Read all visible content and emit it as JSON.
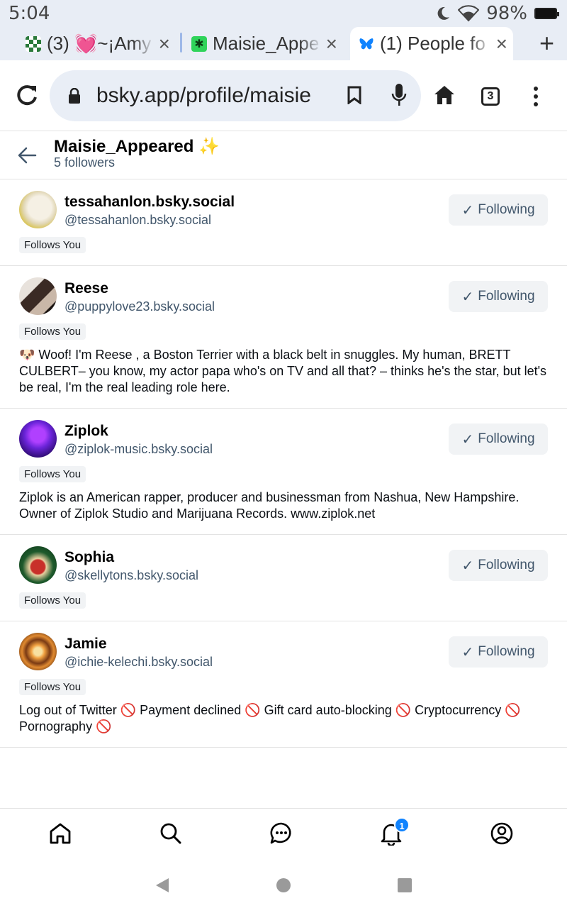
{
  "status_bar": {
    "time": "5:04",
    "battery_pct": "98%",
    "icons": [
      "moon-icon",
      "wifi-icon",
      "battery-icon"
    ]
  },
  "tabs": [
    {
      "favicon": "checker-icon",
      "title": "(3) 💓~¡Amy",
      "active": false
    },
    {
      "favicon": "green-leaf-icon",
      "title": "Maisie_Appe",
      "active": false
    },
    {
      "favicon": "butterfly-icon",
      "title": "(1) People fo",
      "active": true
    }
  ],
  "toolbar": {
    "url": "bsky.app/profile/maisie",
    "tab_count": "3"
  },
  "header": {
    "title": "Maisie_Appeared ✨",
    "subtitle": "5 followers"
  },
  "follow_label": "Following",
  "follows_you_label": "Follows You",
  "followers": [
    {
      "name": "tessahanlon.bsky.social",
      "handle": "@tessahanlon.bsky.social",
      "bio": "",
      "avatar_colors": [
        "#f5f0e4",
        "#d8c24a"
      ]
    },
    {
      "name": "Reese",
      "handle": "@puppylove23.bsky.social",
      "bio": "🐶 Woof! I'm Reese , a Boston Terrier with a black belt in snuggles. My human, BRETT CULBERT– you know, my actor papa who's on TV and all that? – thinks he's the star, but let's be real, I'm the real leading role here.",
      "avatar_colors": [
        "#e8e2dc",
        "#3a2a24"
      ]
    },
    {
      "name": "Ziplok",
      "handle": "@ziplok-music.bsky.social",
      "bio": "Ziplok is an American rapper, producer and businessman from Nashua, New Hampshire. Owner of Ziplok Studio and Marijuana Records. www.ziplok.net",
      "avatar_colors": [
        "#4a1aa8",
        "#b040ff"
      ]
    },
    {
      "name": "Sophia",
      "handle": "@skellytons.bsky.social",
      "bio": "",
      "avatar_colors": [
        "#1e5a2c",
        "#c8302a"
      ]
    },
    {
      "name": "Jamie",
      "handle": "@ichie-kelechi.bsky.social",
      "bio": "Log out of Twitter 🚫 Payment declined 🚫 Gift card auto-blocking 🚫 Cryptocurrency 🚫 Pornography 🚫",
      "avatar_colors": [
        "#7a3a14",
        "#f0a040"
      ]
    }
  ],
  "bottom_nav": {
    "items": [
      "home-icon",
      "search-icon",
      "chat-icon",
      "bell-icon",
      "profile-icon"
    ],
    "notification_count": "1"
  },
  "colors": {
    "accent": "#1083fe",
    "muted_text": "#42576c",
    "chip_bg": "#f1f3f5",
    "browser_bg": "#e8edf5"
  }
}
